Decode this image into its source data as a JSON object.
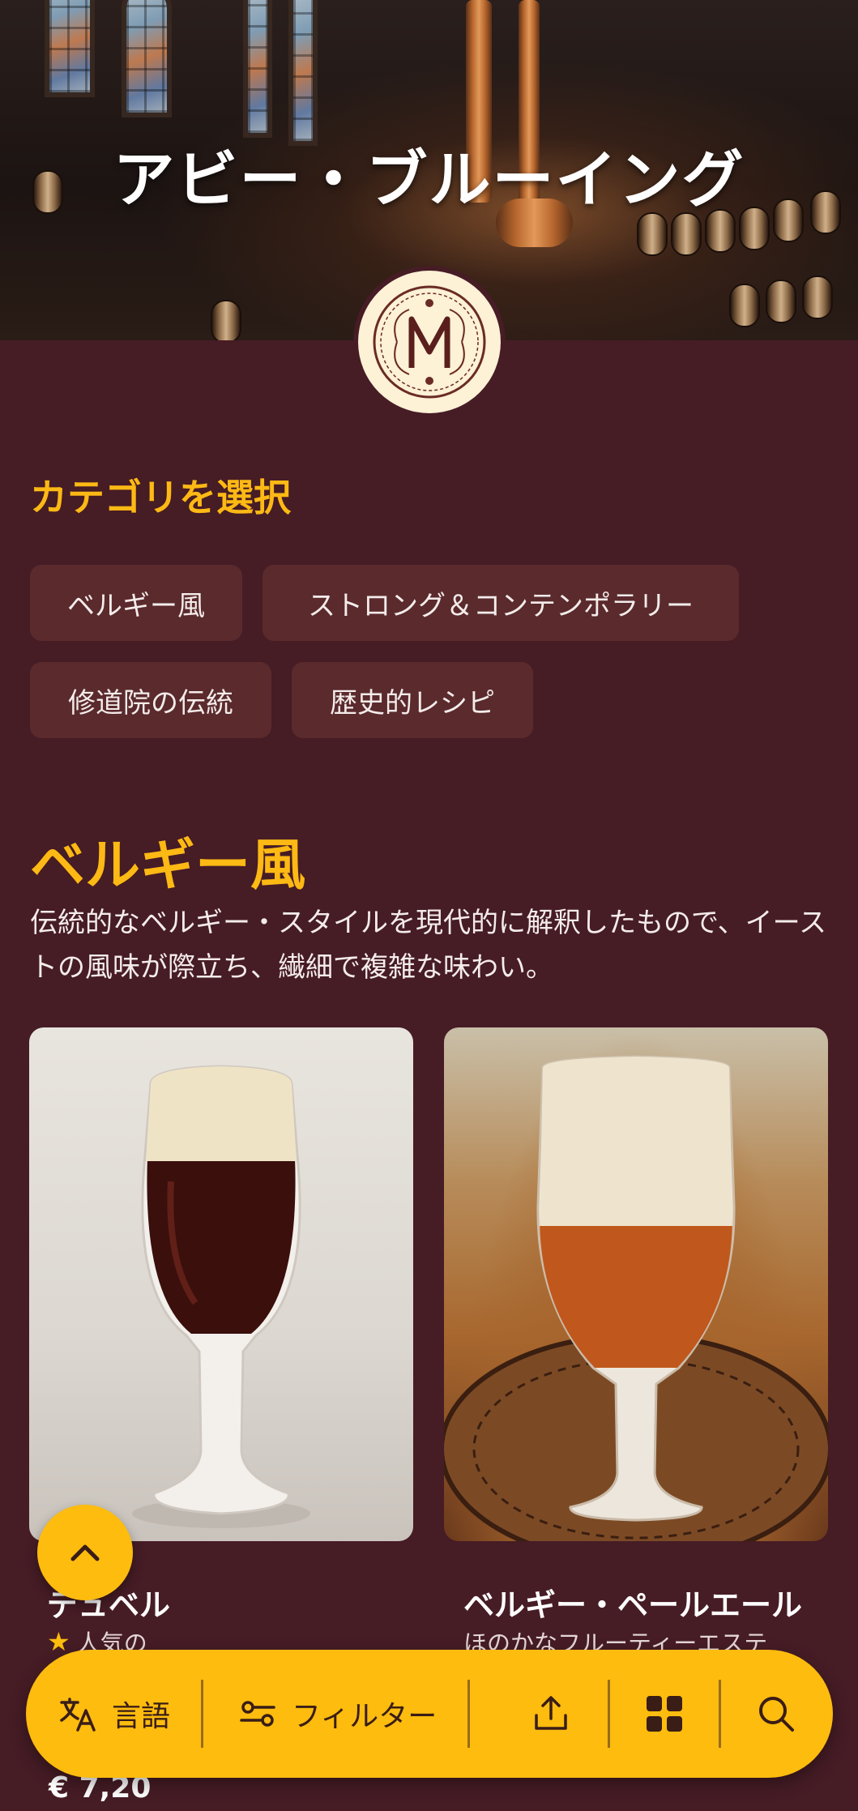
{
  "header": {
    "title": "アビー・ブルーイング"
  },
  "logo": {
    "icon": "monogram-m-icon"
  },
  "categories": {
    "title": "カテゴリを選択",
    "chips": [
      "ベルギー風",
      "ストロング＆コンテンポラリー",
      "修道院の伝統",
      "歴史的レシピ"
    ]
  },
  "section": {
    "title": "ベルギー風",
    "description": "伝統的なベルギー・スタイルを現代的に解釈したもので、イーストの風味が際立ち、繊細で複雑な味わい。"
  },
  "products": [
    {
      "name": "デュベル",
      "subtitle": "人気の",
      "badge_icon": "star-icon",
      "price": "€ 7,20"
    },
    {
      "name": "ベルギー・ペールエール",
      "subtitle": "ほのかなフルーティーエステ"
    }
  ],
  "toolbar": {
    "language_label": "言語",
    "filter_label": "フィルター",
    "share_icon": "share-icon",
    "grid_icon": "grid-icon",
    "search_icon": "search-icon"
  },
  "fab": {
    "icon": "chevron-up-icon"
  },
  "colors": {
    "background": "#461c25",
    "accent": "#fdbc0e",
    "heading": "#fdb914",
    "chip": "#5a2a2d"
  }
}
